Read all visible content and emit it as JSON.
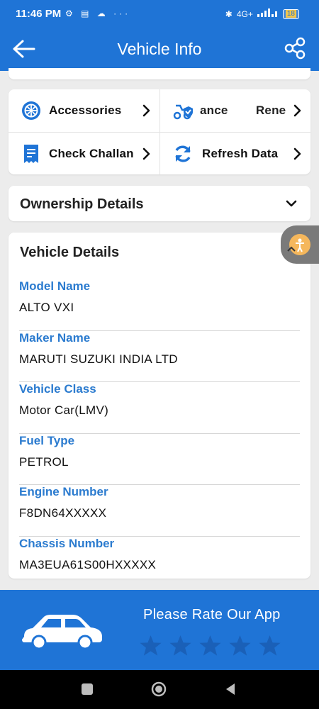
{
  "status_bar": {
    "time": "11:46 PM",
    "left_icons_text": "⚙ ▤ ☁ ···",
    "network": "4G+",
    "battery": "18"
  },
  "app_bar": {
    "title": "Vehicle Info",
    "back_icon": "arrow-left-icon",
    "share_icon": "share-icon"
  },
  "quick_actions": [
    {
      "label": "Accessories",
      "icon": "wheel-icon"
    },
    {
      "label": "ance        Rene",
      "icon": "scooter-shield-icon"
    },
    {
      "label": "Check Challan",
      "icon": "receipt-icon"
    },
    {
      "label": "Refresh Data",
      "icon": "refresh-icon"
    }
  ],
  "ownership": {
    "label": "Ownership Details"
  },
  "vehicle_details": {
    "heading": "Vehicle Details",
    "fields": [
      {
        "label": "Model Name",
        "value": "ALTO VXI"
      },
      {
        "label": "Maker Name",
        "value": "MARUTI SUZUKI INDIA LTD"
      },
      {
        "label": "Vehicle Class",
        "value": "Motor Car(LMV)"
      },
      {
        "label": "Fuel Type",
        "value": "PETROL"
      },
      {
        "label": "Engine Number",
        "value": "F8DN64XXXXX"
      },
      {
        "label": "Chassis Number",
        "value": "MA3EUA61S00HXXXXX"
      }
    ]
  },
  "rate": {
    "text": "Please Rate Our App",
    "star_count": 5
  },
  "colors": {
    "primary": "#1f74d6",
    "label_blue": "#2b7bcf",
    "background": "#ececec",
    "star": "#1a60b8"
  }
}
